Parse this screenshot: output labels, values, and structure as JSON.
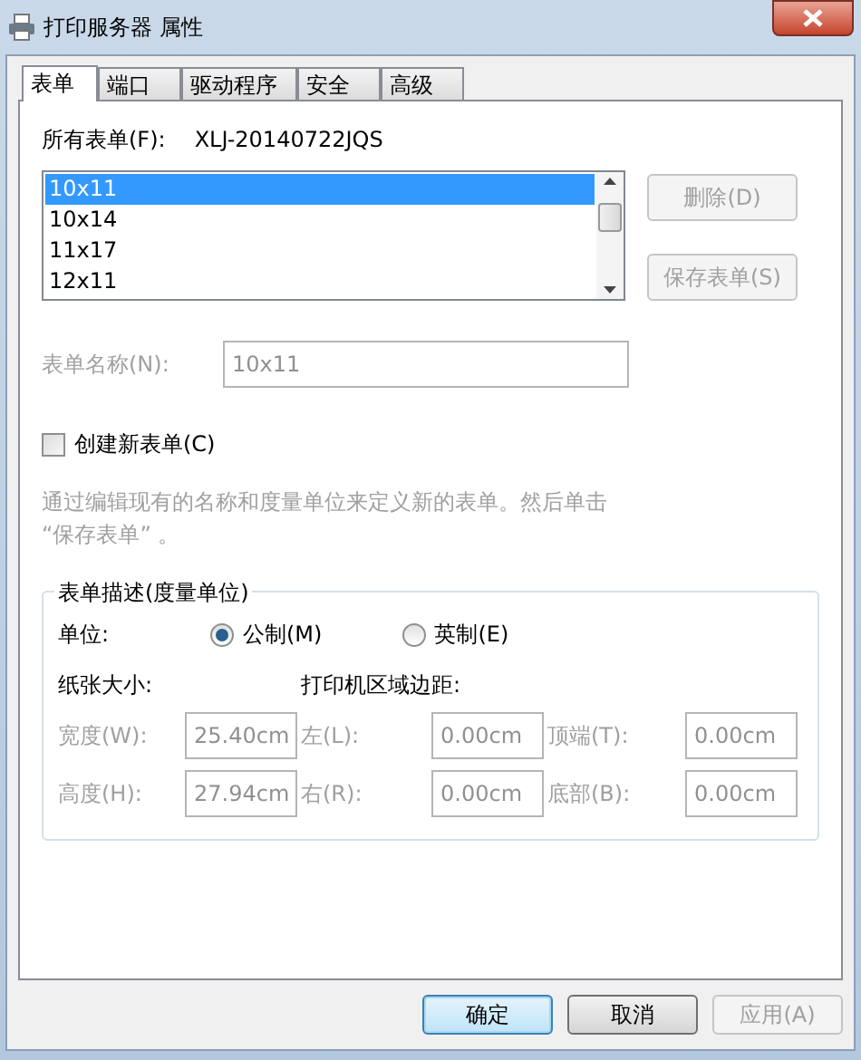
{
  "window": {
    "title": "打印服务器 属性"
  },
  "tabs": [
    {
      "label": "表单",
      "selected": true
    },
    {
      "label": "端口",
      "selected": false
    },
    {
      "label": "驱动程序",
      "selected": false
    },
    {
      "label": "安全",
      "selected": false
    },
    {
      "label": "高级",
      "selected": false
    }
  ],
  "forms_label": "所有表单(F):",
  "server_name": "XLJ-20140722JQS",
  "forms": [
    {
      "label": "10x11",
      "selected": true
    },
    {
      "label": "10x14",
      "selected": false
    },
    {
      "label": "11x17",
      "selected": false
    },
    {
      "label": "12x11",
      "selected": false
    }
  ],
  "form_buttons": [
    {
      "label": "删除(D)",
      "disabled": true
    },
    {
      "label": "保存表单(S)",
      "disabled": true
    }
  ],
  "form_name": {
    "label": "表单名称(N):",
    "value": "10x11",
    "disabled": true
  },
  "create_new": {
    "label": "创建新表单(C)",
    "checked": false
  },
  "description": "通过编辑现有的名称和度量单位来定义新的表单。然后单击 “保存表单” 。",
  "group": {
    "title": "表单描述(度量单位)",
    "units_label": "单位:",
    "units": [
      {
        "label": "公制(M)",
        "selected": true
      },
      {
        "label": "英制(E)",
        "selected": false
      }
    ],
    "paper_label": "纸张大小:",
    "margin_label": "打印机区域边距:",
    "fields": [
      {
        "label": "宽度(W):",
        "value": "25.40cm",
        "disabled": true
      },
      {
        "label": "左(L):",
        "value": "0.00cm",
        "disabled": true
      },
      {
        "label": "顶端(T):",
        "value": "0.00cm",
        "disabled": true
      },
      {
        "label": "高度(H):",
        "value": "27.94cm",
        "disabled": true
      },
      {
        "label": "右(R):",
        "value": "0.00cm",
        "disabled": true
      },
      {
        "label": "底部(B):",
        "value": "0.00cm",
        "disabled": true
      }
    ]
  },
  "footer_buttons": [
    {
      "label": "确定",
      "kind": "default",
      "disabled": false
    },
    {
      "label": "取消",
      "kind": "normal",
      "disabled": false
    },
    {
      "label": "应用(A)",
      "kind": "normal",
      "disabled": true
    }
  ]
}
